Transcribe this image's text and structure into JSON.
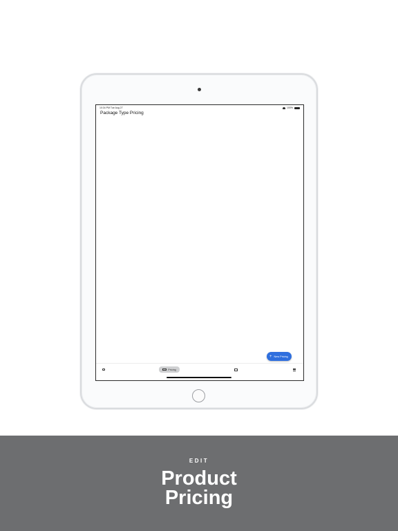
{
  "status_bar": {
    "time_date": "10:34 PM   Tue Aug 27",
    "battery": "100%"
  },
  "screen": {
    "title": "Package Type Pricing"
  },
  "fab": {
    "label": "New Pricing",
    "icon": "plus-icon"
  },
  "tab_bar": {
    "tabs": [
      {
        "icon": "package-icon",
        "label": ""
      },
      {
        "icon": "pricing-icon",
        "label": "Pricing",
        "selected": true
      },
      {
        "icon": "store-icon",
        "label": ""
      },
      {
        "icon": "menu-icon",
        "label": ""
      }
    ]
  },
  "banner": {
    "eyebrow": "EDIT",
    "heading_line1": "Product",
    "heading_line2": "Pricing",
    "background_color": "#6d6e70",
    "text_color": "#ffffff"
  },
  "colors": {
    "accent": "#2f6fde",
    "selected_tab": "#cfd0d2"
  }
}
